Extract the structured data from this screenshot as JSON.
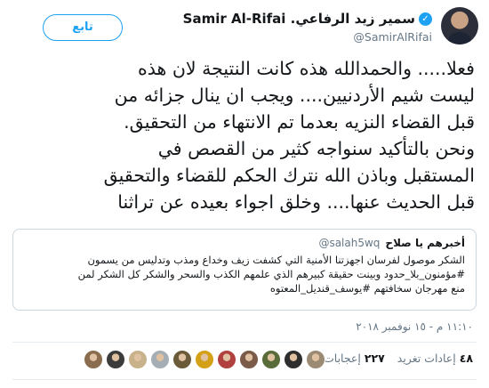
{
  "user": {
    "display_name": "Samir Al-Rifai .سمير زيد الرفاعي",
    "handle": "@SamirAlRifai",
    "verified_glyph": "✓",
    "follow_label": "تابع"
  },
  "tweet": {
    "lines": [
      "فعلا..... والحمدالله هذه كانت النتيجة لان هذه",
      "ليست شيم الأردنيين.... ويجب ان ينال جزائه من",
      "قبل القضاء النزيه بعدما تم الانتهاء من التحقيق.",
      "ونحن بالتأكيد سنواجه كثير من القصص في",
      "المستقبل وباذن الله نترك الحكم للقضاء والتحقيق",
      "قبل الحديث عنها.... وخلق اجواء بعيده عن تراثنا"
    ]
  },
  "quote": {
    "name": "أخبرهم يا صلاح",
    "handle": "@salah5wq",
    "lines": [
      "الشكر موصول لفرسان اجهزتنا الأمنية التي كشفت زيف وخداع ومذب وتدليس من يسمون",
      "#مؤمنون_بلا_حدود وبينت حقيقة كبيرهم الذي علمهم الكذب والسحر والشكر كل الشكر لمن",
      "منع مهرجان سخافتهم #يوسف_قنديل_المعتوه"
    ]
  },
  "meta": {
    "timestamp": "١١:١٠ م - ١٥ نوفمبر ٢٠١٨"
  },
  "stats": {
    "retweets_count": "٤٨",
    "retweets_label": "إعادات تغريد",
    "likes_count": "٢٢٧",
    "likes_label": "إعجابات"
  },
  "likers": [
    "#8a6d4f",
    "#3b3b3b",
    "#c7b28b",
    "#a5adb5",
    "#6b5a3a",
    "#d4a017",
    "#b0413e",
    "#7a5a48",
    "#5a6b3a",
    "#2e2e2e",
    "#9b8b74"
  ],
  "colors": {
    "accent": "#1da1f2",
    "secondary_text": "#657786",
    "border": "#ccd6dd"
  }
}
